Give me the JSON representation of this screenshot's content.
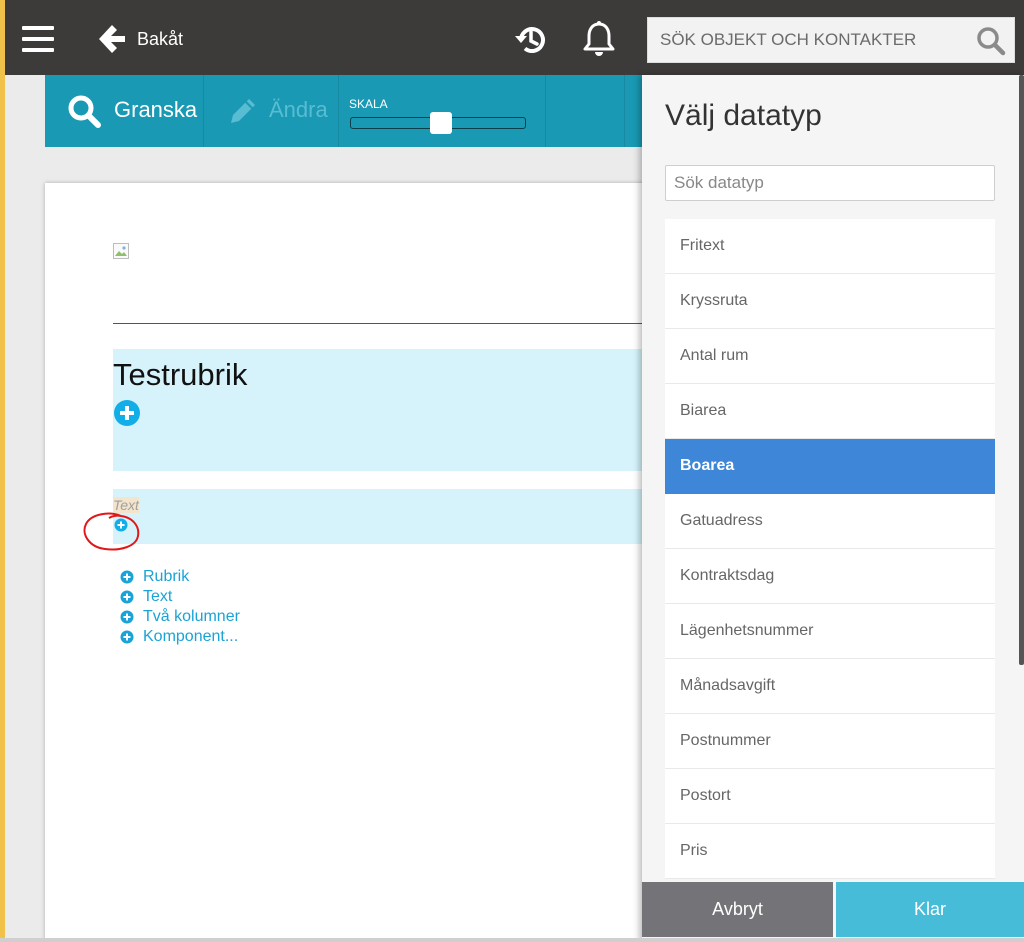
{
  "colors": {
    "topbar": "#3d3a3a",
    "toolbar": "#1999b4",
    "selected_item": "#3e86d7",
    "done_button": "#47bcd9",
    "cancel_button": "#747478",
    "block_background": "#d6f3fb",
    "link": "#1aa3d6",
    "annotation": "#e01818"
  },
  "topbar": {
    "back_label": "Bakåt",
    "search_placeholder": "SÖK OBJEKT OCH KONTAKTER",
    "icons": [
      "menu-icon",
      "arrow-left-icon",
      "history-icon",
      "bell-icon",
      "search-icon"
    ]
  },
  "toolbar": {
    "review_label": "Granska",
    "edit_label": "Ändra",
    "scale_label": "SKALA",
    "scale_level": 0.52
  },
  "document": {
    "heading": "Testrubrik",
    "text_placeholder": "Text",
    "add_menu": [
      {
        "label": "Rubrik"
      },
      {
        "label": "Text"
      },
      {
        "label": "Två kolumner"
      },
      {
        "label": "Komponent..."
      }
    ]
  },
  "panel": {
    "title": "Välj datatyp",
    "search_placeholder": "Sök datatyp",
    "items": [
      {
        "label": "Fritext",
        "selected": false
      },
      {
        "label": "Kryssruta",
        "selected": false
      },
      {
        "label": "Antal rum",
        "selected": false
      },
      {
        "label": "Biarea",
        "selected": false
      },
      {
        "label": "Boarea",
        "selected": true
      },
      {
        "label": "Gatuadress",
        "selected": false
      },
      {
        "label": "Kontraktsdag",
        "selected": false
      },
      {
        "label": "Lägenhetsnummer",
        "selected": false
      },
      {
        "label": "Månadsavgift",
        "selected": false
      },
      {
        "label": "Postnummer",
        "selected": false
      },
      {
        "label": "Postort",
        "selected": false
      },
      {
        "label": "Pris",
        "selected": false
      }
    ],
    "cancel_label": "Avbryt",
    "done_label": "Klar"
  }
}
